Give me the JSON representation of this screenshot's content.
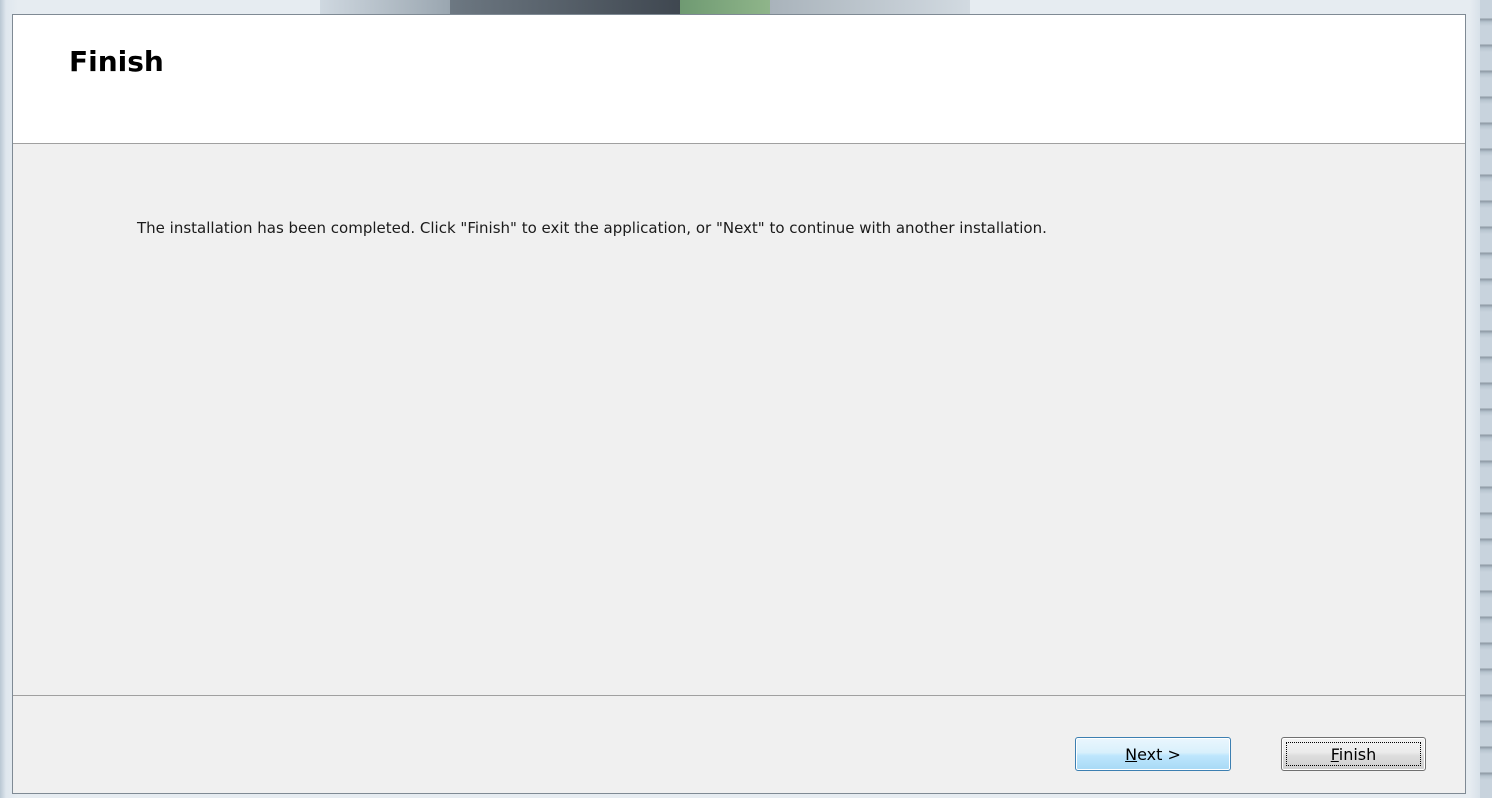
{
  "dialog": {
    "title": "Finish",
    "message": "The installation has been completed. Click \"Finish\" to exit the application, or \"Next\" to continue with another installation.",
    "buttons": {
      "next": {
        "mnemonic": "N",
        "rest": "ext >"
      },
      "finish": {
        "mnemonic": "F",
        "rest": "inish"
      }
    }
  },
  "colors": {
    "header_bg": "#ffffff",
    "body_bg": "#f0f0f0",
    "next_border": "#3c7fb1",
    "finish_border": "#707070"
  }
}
